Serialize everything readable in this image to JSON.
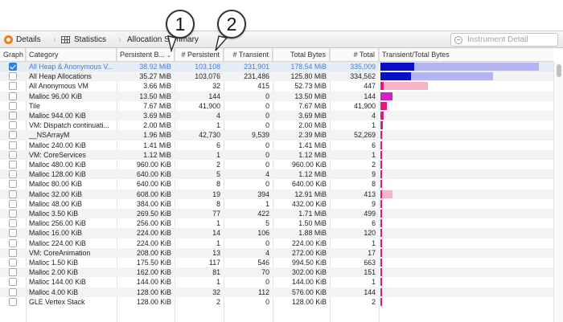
{
  "toolbar": {
    "crumb_details": "Details",
    "crumb_statistics": "Statistics",
    "crumb_allocation_summary": "Allocation Summary",
    "search_placeholder": "Instrument Detail"
  },
  "columns": {
    "graph": "Graph",
    "category": "Category",
    "persistent_bytes": "Persistent B...",
    "num_persistent": "# Persistent",
    "num_transient": "# Transient",
    "total_bytes": "Total Bytes",
    "num_total": "# Total",
    "transient_total_bytes": "Transient/Total Bytes"
  },
  "callouts": [
    "1",
    "2"
  ],
  "colors": {
    "selected_row_text": "#3f7fe0",
    "bar_persistent": "#0a10c8",
    "bar_transient": "#b4b4f2",
    "bar_pink_strong": "#e1197d",
    "bar_pink_light": "#f6b4c8",
    "bar_magenta": "#d61ec8",
    "checkbox_on": "#2d86f2"
  },
  "rows": [
    {
      "graph": true,
      "category": "All Heap & Anonymous V...",
      "persistent_bytes": "38.92 MiB",
      "num_persistent": "103,108",
      "num_transient": "231,901",
      "total_bytes": "178.54 MiB",
      "num_total": "335,009",
      "bar_persistent": 0.2,
      "bar_total": 0.93,
      "bar_color": "#0a10c8",
      "bar_bg": "#b4b4f2"
    },
    {
      "graph": false,
      "category": "All Heap Allocations",
      "persistent_bytes": "35.27 MiB",
      "num_persistent": "103,076",
      "num_transient": "231,486",
      "total_bytes": "125.80 MiB",
      "num_total": "334,562",
      "bar_persistent": 0.18,
      "bar_total": 0.66,
      "bar_color": "#0a10c8",
      "bar_bg": "#b4b4f2"
    },
    {
      "graph": false,
      "category": "All Anonymous VM",
      "persistent_bytes": "3.66 MiB",
      "num_persistent": "32",
      "num_transient": "415",
      "total_bytes": "52.73 MiB",
      "num_total": "447",
      "bar_persistent": 0.02,
      "bar_total": 0.28,
      "bar_color": "#e1197d",
      "bar_bg": "#f6b4c8"
    },
    {
      "graph": false,
      "category": "Malloc 96.00 KiB",
      "persistent_bytes": "13.50 MiB",
      "num_persistent": "144",
      "num_transient": "0",
      "total_bytes": "13.50 MiB",
      "num_total": "144",
      "bar_persistent": 0.07,
      "bar_total": 0.07,
      "bar_color": "#d61ec8",
      "bar_bg": "#f6b4c8"
    },
    {
      "graph": false,
      "category": "Tile",
      "persistent_bytes": "7.67 MiB",
      "num_persistent": "41,900",
      "num_transient": "0",
      "total_bytes": "7.67 MiB",
      "num_total": "41,900",
      "bar_persistent": 0.04,
      "bar_total": 0.04,
      "bar_color": "#e1197d",
      "bar_bg": "#f6b4c8"
    },
    {
      "graph": false,
      "category": "Malloc 944.00 KiB",
      "persistent_bytes": "3.69 MiB",
      "num_persistent": "4",
      "num_transient": "0",
      "total_bytes": "3.69 MiB",
      "num_total": "4",
      "bar_persistent": 0.02,
      "bar_total": 0.02,
      "bar_color": "#e1197d",
      "bar_bg": "#f6b4c8"
    },
    {
      "graph": false,
      "category": "VM: Dispatch continuati...",
      "persistent_bytes": "2.00 MiB",
      "num_persistent": "1",
      "num_transient": "0",
      "total_bytes": "2.00 MiB",
      "num_total": "1",
      "bar_persistent": 0.012,
      "bar_total": 0.012,
      "bar_color": "#e1197d",
      "bar_bg": "#f6b4c8"
    },
    {
      "graph": false,
      "category": "__NSArrayM",
      "persistent_bytes": "1.96 MiB",
      "num_persistent": "42,730",
      "num_transient": "9,539",
      "total_bytes": "2.39 MiB",
      "num_total": "52,269",
      "bar_persistent": 0.011,
      "bar_total": 0.014,
      "bar_color": "#e1197d",
      "bar_bg": "#f6b4c8"
    },
    {
      "graph": false,
      "category": "Malloc 240.00 KiB",
      "persistent_bytes": "1.41 MiB",
      "num_persistent": "6",
      "num_transient": "0",
      "total_bytes": "1.41 MiB",
      "num_total": "6",
      "bar_persistent": 0.008,
      "bar_total": 0.008,
      "bar_color": "#e1197d",
      "bar_bg": "#f6b4c8"
    },
    {
      "graph": false,
      "category": "VM: CoreServices",
      "persistent_bytes": "1.12 MiB",
      "num_persistent": "1",
      "num_transient": "0",
      "total_bytes": "1.12 MiB",
      "num_total": "1",
      "bar_persistent": 0.007,
      "bar_total": 0.007,
      "bar_color": "#e1197d",
      "bar_bg": "#f6b4c8"
    },
    {
      "graph": false,
      "category": "Malloc 480.00 KiB",
      "persistent_bytes": "960.00 KiB",
      "num_persistent": "2",
      "num_transient": "0",
      "total_bytes": "960.00 KiB",
      "num_total": "2",
      "bar_persistent": 0.006,
      "bar_total": 0.006,
      "bar_color": "#e1197d",
      "bar_bg": "#f6b4c8"
    },
    {
      "graph": false,
      "category": "Malloc 128.00 KiB",
      "persistent_bytes": "640.00 KiB",
      "num_persistent": "5",
      "num_transient": "4",
      "total_bytes": "1.12 MiB",
      "num_total": "9",
      "bar_persistent": 0.004,
      "bar_total": 0.007,
      "bar_color": "#e1197d",
      "bar_bg": "#f6b4c8"
    },
    {
      "graph": false,
      "category": "Malloc 80.00 KiB",
      "persistent_bytes": "640.00 KiB",
      "num_persistent": "8",
      "num_transient": "0",
      "total_bytes": "640.00 KiB",
      "num_total": "8",
      "bar_persistent": 0.004,
      "bar_total": 0.004,
      "bar_color": "#e1197d",
      "bar_bg": "#f6b4c8"
    },
    {
      "graph": false,
      "category": "Malloc 32.00 KiB",
      "persistent_bytes": "608.00 KiB",
      "num_persistent": "19",
      "num_transient": "394",
      "total_bytes": "12.91 MiB",
      "num_total": "413",
      "bar_persistent": 0.004,
      "bar_total": 0.07,
      "bar_color": "#e1197d",
      "bar_bg": "#f6b4c8"
    },
    {
      "graph": false,
      "category": "Malloc 48.00 KiB",
      "persistent_bytes": "384.00 KiB",
      "num_persistent": "8",
      "num_transient": "1",
      "total_bytes": "432.00 KiB",
      "num_total": "9",
      "bar_persistent": 0.003,
      "bar_total": 0.003,
      "bar_color": "#e1197d",
      "bar_bg": "#f6b4c8"
    },
    {
      "graph": false,
      "category": "Malloc 3.50 KiB",
      "persistent_bytes": "269.50 KiB",
      "num_persistent": "77",
      "num_transient": "422",
      "total_bytes": "1.71 MiB",
      "num_total": "499",
      "bar_persistent": 0.002,
      "bar_total": 0.01,
      "bar_color": "#e1197d",
      "bar_bg": "#f6b4c8"
    },
    {
      "graph": false,
      "category": "Malloc 256.00 KiB",
      "persistent_bytes": "256.00 KiB",
      "num_persistent": "1",
      "num_transient": "5",
      "total_bytes": "1.50 MiB",
      "num_total": "6",
      "bar_persistent": 0.002,
      "bar_total": 0.008,
      "bar_color": "#e1197d",
      "bar_bg": "#f6b4c8"
    },
    {
      "graph": false,
      "category": "Malloc 16.00 KiB",
      "persistent_bytes": "224.00 KiB",
      "num_persistent": "14",
      "num_transient": "106",
      "total_bytes": "1.88 MiB",
      "num_total": "120",
      "bar_persistent": 0.002,
      "bar_total": 0.01,
      "bar_color": "#e1197d",
      "bar_bg": "#f6b4c8"
    },
    {
      "graph": false,
      "category": "Malloc 224.00 KiB",
      "persistent_bytes": "224.00 KiB",
      "num_persistent": "1",
      "num_transient": "0",
      "total_bytes": "224.00 KiB",
      "num_total": "1",
      "bar_persistent": 0.002,
      "bar_total": 0.002,
      "bar_color": "#e1197d",
      "bar_bg": "#f6b4c8"
    },
    {
      "graph": false,
      "category": "VM: CoreAnimation",
      "persistent_bytes": "208.00 KiB",
      "num_persistent": "13",
      "num_transient": "4",
      "total_bytes": "272.00 KiB",
      "num_total": "17",
      "bar_persistent": 0.002,
      "bar_total": 0.002,
      "bar_color": "#e1197d",
      "bar_bg": "#f6b4c8"
    },
    {
      "graph": false,
      "category": "Malloc 1.50 KiB",
      "persistent_bytes": "175.50 KiB",
      "num_persistent": "117",
      "num_transient": "546",
      "total_bytes": "994.50 KiB",
      "num_total": "663",
      "bar_persistent": 0.001,
      "bar_total": 0.006,
      "bar_color": "#e1197d",
      "bar_bg": "#f6b4c8"
    },
    {
      "graph": false,
      "category": "Malloc 2.00 KiB",
      "persistent_bytes": "162.00 KiB",
      "num_persistent": "81",
      "num_transient": "70",
      "total_bytes": "302.00 KiB",
      "num_total": "151",
      "bar_persistent": 0.001,
      "bar_total": 0.002,
      "bar_color": "#e1197d",
      "bar_bg": "#f6b4c8"
    },
    {
      "graph": false,
      "category": "Malloc 144.00 KiB",
      "persistent_bytes": "144.00 KiB",
      "num_persistent": "1",
      "num_transient": "0",
      "total_bytes": "144.00 KiB",
      "num_total": "1",
      "bar_persistent": 0.001,
      "bar_total": 0.001,
      "bar_color": "#e1197d",
      "bar_bg": "#f6b4c8"
    },
    {
      "graph": false,
      "category": "Malloc 4.00 KiB",
      "persistent_bytes": "128.00 KiB",
      "num_persistent": "32",
      "num_transient": "112",
      "total_bytes": "576.00 KiB",
      "num_total": "144",
      "bar_persistent": 0.001,
      "bar_total": 0.003,
      "bar_color": "#e1197d",
      "bar_bg": "#f6b4c8"
    },
    {
      "graph": false,
      "category": "GLE Vertex Stack",
      "persistent_bytes": "128.00 KiB",
      "num_persistent": "2",
      "num_transient": "0",
      "total_bytes": "128.00 KiB",
      "num_total": "2",
      "bar_persistent": 0.001,
      "bar_total": 0.001,
      "bar_color": "#e1197d",
      "bar_bg": "#f6b4c8"
    }
  ]
}
